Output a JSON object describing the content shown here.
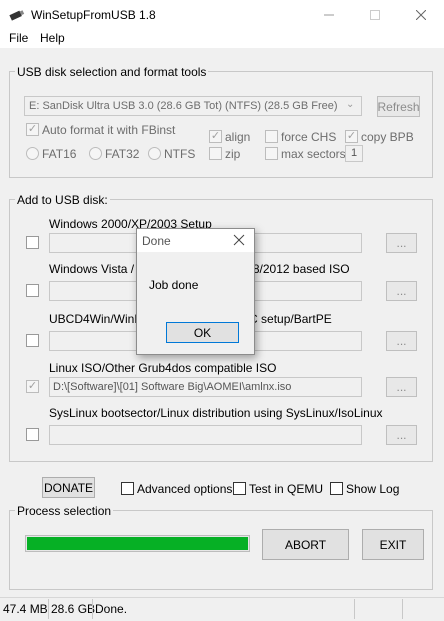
{
  "window": {
    "title": "WinSetupFromUSB 1.8"
  },
  "menu": {
    "file": "File",
    "help": "Help"
  },
  "usb_section": {
    "label": "USB disk selection and format tools",
    "disk": "E: SanDisk Ultra USB 3.0 (28.6 GB Tot) (NTFS) (28.5 GB Free)",
    "refresh": "Refresh",
    "auto_format": "Auto format it with FBinst",
    "align": "align",
    "zip": "zip",
    "force_chs": "force CHS",
    "max_sectors": "max sectors",
    "copy_bpb": "copy BPB",
    "max_sectors_value": "1",
    "fat16": "FAT16",
    "fat32": "FAT32",
    "ntfs": "NTFS"
  },
  "add_section": {
    "label": "Add to USB disk:",
    "browse": "...",
    "items": [
      {
        "label": "Windows 2000/XP/2003 Setup",
        "path": ""
      },
      {
        "label": "Windows Vista / 7 / 8 / 10 / Server 2008/2012 based ISO",
        "path": ""
      },
      {
        "label": "UBCD4Win/WinBuilder/Windows FLPC setup/BartPE",
        "path": ""
      },
      {
        "label": "Linux ISO/Other Grub4dos compatible ISO",
        "path": "D:\\[Software]\\[01] Software Big\\AOMEI\\amlnx.iso"
      },
      {
        "label": "SysLinux bootsector/Linux distribution using SysLinux/IsoLinux",
        "path": ""
      }
    ]
  },
  "options": {
    "donate": "DONATE",
    "advanced": "Advanced options",
    "qemu": "Test in QEMU",
    "show_log": "Show Log"
  },
  "process": {
    "label": "Process selection",
    "progress": 1.0,
    "abort": "ABORT",
    "exit": "EXIT"
  },
  "status": {
    "size1": "47.4 MB",
    "size2": "28.6 GB",
    "message": "Done."
  },
  "dialog": {
    "title": "Done",
    "message": "Job done",
    "ok": "OK"
  },
  "colors": {
    "progress": "#06b025",
    "window_bg": "#f0f0f0"
  }
}
